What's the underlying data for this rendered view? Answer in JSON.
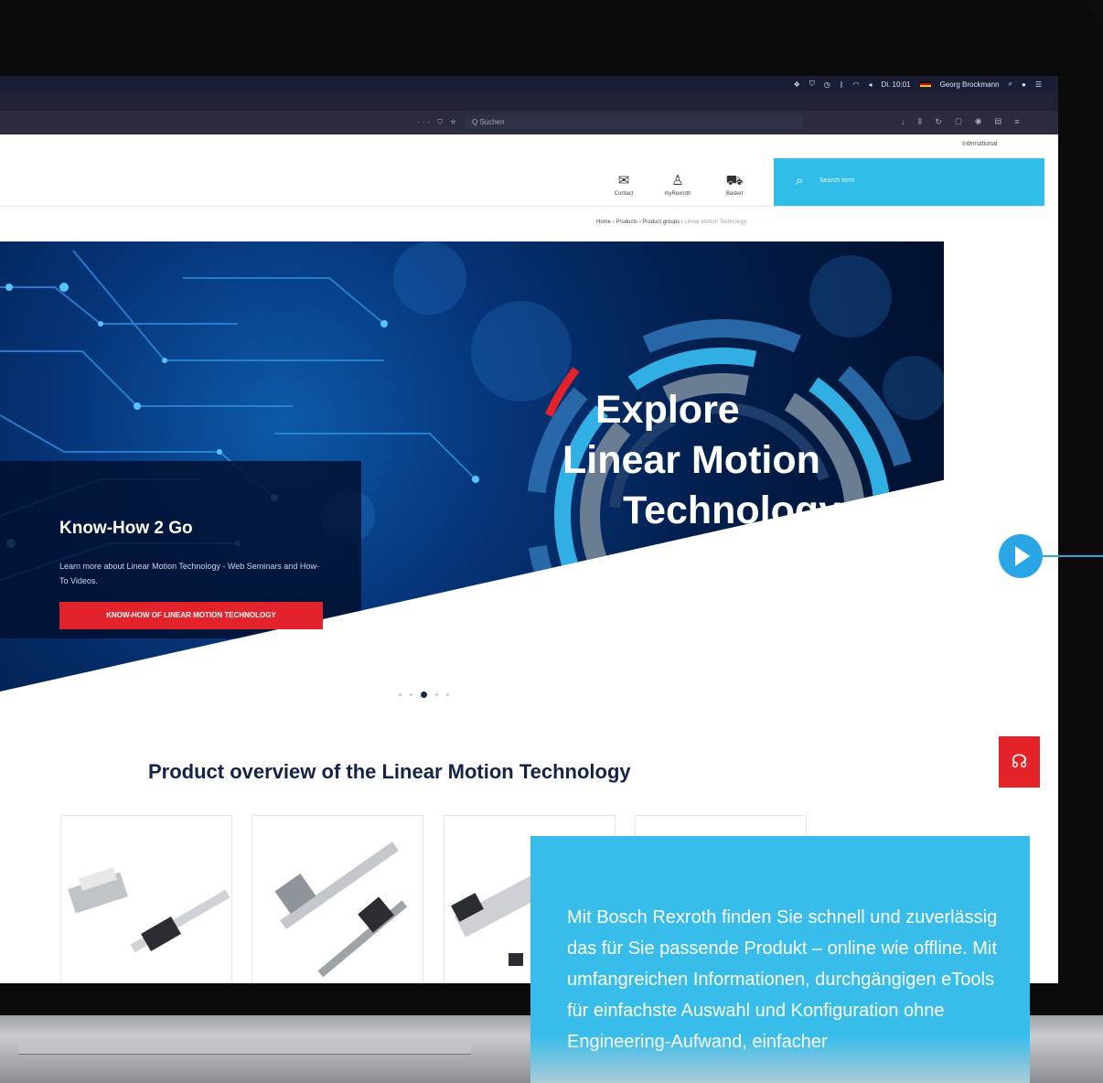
{
  "menubar": {
    "icons": [
      "dropbox-icon",
      "shield-icon",
      "clock-icon",
      "bluetooth-icon",
      "wifi-icon",
      "volume-icon"
    ],
    "clock": "Di. 10:01",
    "user": "Georg Brockmann"
  },
  "browser": {
    "page_actions": "··· ⛉ ☆",
    "search_placeholder": "Q Suchen",
    "tool_icons": "↓ ⫴ ↻ ▢ ◉ ▤ ≡"
  },
  "site": {
    "region_link": "International",
    "nav": [
      {
        "icon": "✉",
        "label": "Contact"
      },
      {
        "icon": "♙",
        "label": "myRexroth"
      },
      {
        "icon": "⛟",
        "label": "Basket"
      }
    ],
    "search_placeholder": "Search term"
  },
  "breadcrumb": {
    "items": [
      "Home",
      "Products",
      "Product groups"
    ],
    "sep": "›",
    "current": "Linear Motion Technology"
  },
  "hero": {
    "title_line1": "Explore",
    "title_line2": "Linear Motion",
    "title_line3": "Technology",
    "card_title": "Know-How 2 Go",
    "card_text": "Learn more about Linear Motion Technology - Web Seminars and How-To Videos.",
    "card_button": "KNOW-HOW OF LINEAR MOTION TECHNOLOGY",
    "slides_total": 5,
    "active_slide": 3
  },
  "section": {
    "title": "Product overview of the Linear Motion Technology"
  },
  "overlay": {
    "text": "Mit Bosch Rexroth finden Sie schnell und zuverlässig das für Sie passende Produkt – online wie offline. Mit umfangreichen Informationen, durchgängigen eTools für einfachste Auswahl und Konfiguration ohne Engineering-Aufwand, einfacher"
  },
  "colors": {
    "accent": "#31bde9",
    "brand_red": "#e2232b",
    "navy": "#15234a",
    "play_blue": "#2aa5e6"
  }
}
